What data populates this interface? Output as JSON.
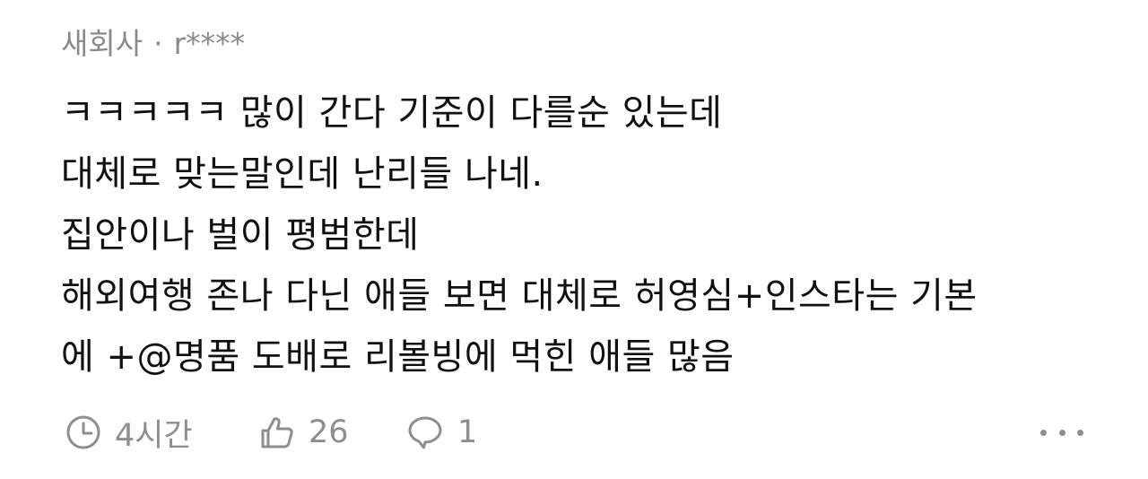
{
  "comment": {
    "company": "새회사",
    "separator": "·",
    "author": "r****",
    "lines": [
      "ㅋㅋㅋㅋㅋ 많이 간다 기준이 다를순 있는데",
      "대체로 맞는말인데 난리들 나네.",
      "집안이나 벌이 평범한데",
      "해외여행 존나 다닌 애들 보면 대체로 허영심+인스타는 기본",
      "에 +@명품 도배로 리볼빙에 먹힌 애들 많음"
    ],
    "time": "4시간",
    "likes": "26",
    "replies": "1"
  },
  "icons": {
    "time": "clock-icon",
    "like": "thumbs-up-icon",
    "reply": "speech-bubble-icon",
    "more": "more-dots-icon"
  },
  "colors": {
    "meta": "#8a8a8a",
    "text": "#111111",
    "icon": "#8e8e8e"
  }
}
